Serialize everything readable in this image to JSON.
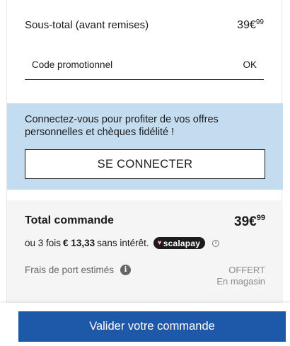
{
  "subtotal": {
    "label": "Sous-total (avant remises)",
    "price_main": "39€",
    "price_cents": "99"
  },
  "promo": {
    "placeholder": "Code promotionnel",
    "ok_label": "OK"
  },
  "login": {
    "message": "Connectez-vous pour profiter de vos offres personnelles et chèques fidélité !",
    "button_label": "SE CONNECTER",
    "background_color": "#c4dcef"
  },
  "total": {
    "label": "Total commande",
    "price_main": "39€",
    "price_cents": "99",
    "installment_prefix": "ou 3 fois",
    "installment_amount": "€ 13,33",
    "installment_suffix": "sans intérêt.",
    "scalapay_label": "scalapay",
    "info_icon": "i"
  },
  "shipping": {
    "label": "Frais de port estimés",
    "info_icon": "i",
    "value": "OFFERT",
    "sub_value": "En magasin"
  },
  "checkout": {
    "button_label": "Valider votre commande",
    "button_color": "#1e58a8"
  }
}
